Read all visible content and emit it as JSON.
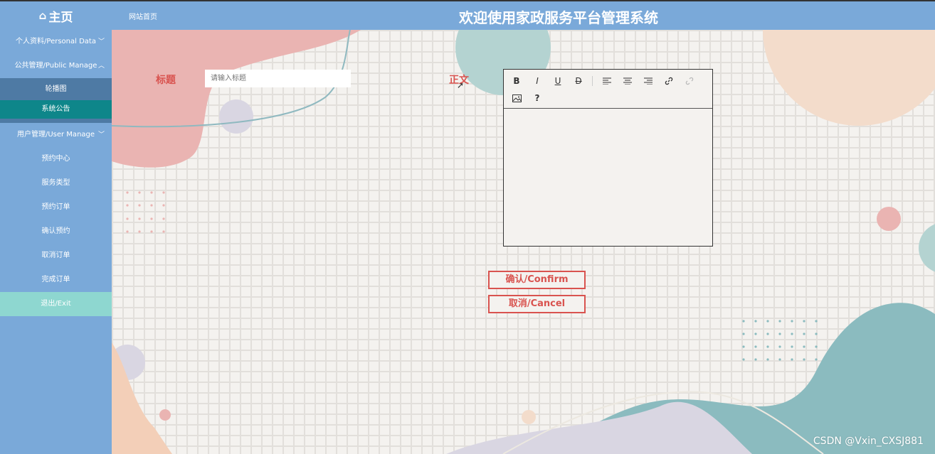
{
  "header": {
    "home_label": "主页",
    "home_icon": "home-icon",
    "breadcrumb": "网站首页",
    "title": "欢迎使用家政服务平台管理系统"
  },
  "sidebar": {
    "items": [
      {
        "label": "个人资料/Personal Data"
      },
      {
        "label": "公共管理/Public Manage"
      },
      {
        "label": "轮播图"
      },
      {
        "label": "系统公告"
      },
      {
        "label": "用户管理/User Manage"
      },
      {
        "label": "预约中心"
      },
      {
        "label": "服务类型"
      },
      {
        "label": "预约订单"
      },
      {
        "label": "确认预约"
      },
      {
        "label": "取消订单"
      },
      {
        "label": "完成订单"
      },
      {
        "label": "退出/Exit"
      }
    ]
  },
  "form": {
    "title_label": "标题",
    "title_placeholder": "请输入标题",
    "title_value": "",
    "content_label": "正文",
    "toolbar": {
      "bold": "B",
      "italic": "I",
      "underline": "U",
      "strike": "D",
      "help": "?"
    }
  },
  "actions": {
    "confirm": "确认/Confirm",
    "cancel": "取消/Cancel"
  },
  "watermark": "CSDN @Vxin_CXSJ881",
  "colors": {
    "primary": "#7aa9d9",
    "active": "#0e868a",
    "exit": "#8ed7d0",
    "accent_red": "#d9534f"
  }
}
